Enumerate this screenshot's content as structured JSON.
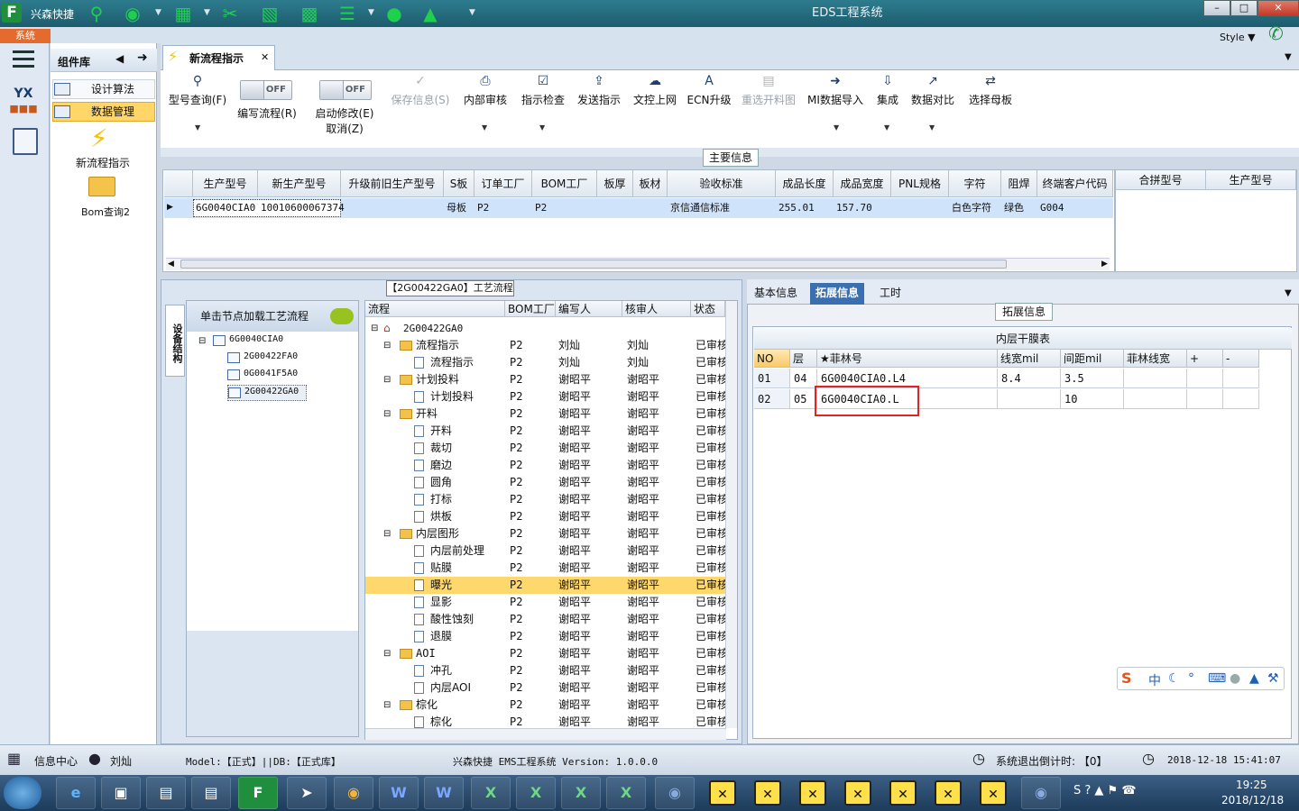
{
  "window": {
    "app_name": "兴森快捷",
    "title": "EDS工程系统",
    "menu_tab": "系统",
    "style_label": "Style"
  },
  "sidebar": {
    "panel_title": "组件库",
    "items": [
      {
        "label": "设计算法"
      },
      {
        "label": "数据管理"
      }
    ],
    "shortcuts": [
      {
        "label": "新流程指示"
      },
      {
        "label": "Bom查询2"
      }
    ]
  },
  "doc_tab": {
    "label": "新流程指示"
  },
  "toolbar": {
    "model_query": "型号查询(F)",
    "toggle_off": "OFF",
    "edit_flow": "编写流程(R)",
    "start_modify": "启动修改(E)",
    "cancel": "取消(Z)",
    "save_info": "保存信息(S)",
    "internal_review": "内部审核",
    "instruction_check": "指示检查",
    "send_instruction": "发送指示",
    "doc_control": "文控上网",
    "ecn_upgrade": "ECN升级",
    "reselect_cut": "重选开料图",
    "mi_import": "MI数据导入",
    "integrate": "集成",
    "data_compare": "数据对比",
    "select_master": "选择母板"
  },
  "main_info": {
    "legend": "主要信息",
    "columns": [
      "生产型号",
      "新生产型号",
      "升级前旧生产型号",
      "S板",
      "订单工厂",
      "BOM工厂",
      "板厚",
      "板材",
      "验收标准",
      "成品长度",
      "成品宽度",
      "PNL规格",
      "字符",
      "阻焊",
      "终端客户代码"
    ],
    "row": [
      "6G0040CIA0",
      "10010600067374",
      "",
      "母板",
      "P2",
      "P2",
      "",
      "",
      "京信通信标准",
      "255.01",
      "157.70",
      "",
      "白色字符",
      "绿色",
      "G004"
    ],
    "side_columns": [
      "合拼型号",
      "生产型号"
    ]
  },
  "flow_panel": {
    "legend": "【2G00422GA0】工艺流程",
    "vert_tab": "设备结构",
    "node_head": "单击节点加载工艺流程",
    "tree": [
      {
        "label": "6G0040CIA0"
      },
      {
        "label": "2G00422FA0"
      },
      {
        "label": "0G0041F5A0"
      },
      {
        "label": "2G00422GA0"
      }
    ],
    "columns": [
      "流程",
      "BOM工厂",
      "编写人",
      "核审人",
      "状态"
    ],
    "root": "2G00422GA0",
    "rows": [
      {
        "name": "流程指示",
        "type": "folder",
        "bom": "P2",
        "writer": "刘灿",
        "reviewer": "刘灿",
        "status": "已审核"
      },
      {
        "name": "流程指示",
        "type": "doc",
        "bom": "P2",
        "writer": "刘灿",
        "reviewer": "刘灿",
        "status": "已审核"
      },
      {
        "name": "计划投料",
        "type": "folder",
        "bom": "P2",
        "writer": "谢昭平",
        "reviewer": "谢昭平",
        "status": "已审核"
      },
      {
        "name": "计划投料",
        "type": "doc",
        "bom": "P2",
        "writer": "谢昭平",
        "reviewer": "谢昭平",
        "status": "已审核"
      },
      {
        "name": "开料",
        "type": "folder",
        "bom": "P2",
        "writer": "谢昭平",
        "reviewer": "谢昭平",
        "status": "已审核"
      },
      {
        "name": "开料",
        "type": "doc",
        "bom": "P2",
        "writer": "谢昭平",
        "reviewer": "谢昭平",
        "status": "已审核"
      },
      {
        "name": "裁切",
        "type": "doc",
        "bom": "P2",
        "writer": "谢昭平",
        "reviewer": "谢昭平",
        "status": "已审核"
      },
      {
        "name": "磨边",
        "type": "doc",
        "bom": "P2",
        "writer": "谢昭平",
        "reviewer": "谢昭平",
        "status": "已审核"
      },
      {
        "name": "圆角",
        "type": "doc",
        "bom": "P2",
        "writer": "谢昭平",
        "reviewer": "谢昭平",
        "status": "已审核"
      },
      {
        "name": "打标",
        "type": "doc",
        "bom": "P2",
        "writer": "谢昭平",
        "reviewer": "谢昭平",
        "status": "已审核"
      },
      {
        "name": "烘板",
        "type": "doc",
        "bom": "P2",
        "writer": "谢昭平",
        "reviewer": "谢昭平",
        "status": "已审核"
      },
      {
        "name": "内层图形",
        "type": "folder",
        "bom": "P2",
        "writer": "谢昭平",
        "reviewer": "谢昭平",
        "status": "已审核"
      },
      {
        "name": "内层前处理",
        "type": "doc",
        "bom": "P2",
        "writer": "谢昭平",
        "reviewer": "谢昭平",
        "status": "已审核"
      },
      {
        "name": "贴膜",
        "type": "doc",
        "bom": "P2",
        "writer": "谢昭平",
        "reviewer": "谢昭平",
        "status": "已审核"
      },
      {
        "name": "曝光",
        "type": "doc",
        "bom": "P2",
        "writer": "谢昭平",
        "reviewer": "谢昭平",
        "status": "已审核"
      },
      {
        "name": "显影",
        "type": "doc",
        "bom": "P2",
        "writer": "谢昭平",
        "reviewer": "谢昭平",
        "status": "已审核"
      },
      {
        "name": "酸性蚀刻",
        "type": "doc",
        "bom": "P2",
        "writer": "谢昭平",
        "reviewer": "谢昭平",
        "status": "已审核"
      },
      {
        "name": "退膜",
        "type": "doc",
        "bom": "P2",
        "writer": "谢昭平",
        "reviewer": "谢昭平",
        "status": "已审核"
      },
      {
        "name": "AOI",
        "type": "folder",
        "bom": "P2",
        "writer": "谢昭平",
        "reviewer": "谢昭平",
        "status": "已审核"
      },
      {
        "name": "冲孔",
        "type": "doc",
        "bom": "P2",
        "writer": "谢昭平",
        "reviewer": "谢昭平",
        "status": "已审核"
      },
      {
        "name": "内层AOI",
        "type": "doc",
        "bom": "P2",
        "writer": "谢昭平",
        "reviewer": "谢昭平",
        "status": "已审核"
      },
      {
        "name": "棕化",
        "type": "folder",
        "bom": "P2",
        "writer": "谢昭平",
        "reviewer": "谢昭平",
        "status": "已审核"
      },
      {
        "name": "棕化",
        "type": "doc",
        "bom": "P2",
        "writer": "谢昭平",
        "reviewer": "谢昭平",
        "status": "已审核"
      }
    ]
  },
  "right_panel": {
    "tabs": [
      "基本信息",
      "拓展信息",
      "工时"
    ],
    "legend": "拓展信息",
    "table_title": "内层干膜表",
    "columns": [
      "NO",
      "层",
      "★菲林号",
      "线宽mil",
      "间距mil",
      "菲林线宽",
      "+",
      "-"
    ],
    "rows": [
      [
        "01",
        "04",
        "6G0040CIA0.L4",
        "8.4",
        "3.5",
        "",
        "",
        ""
      ],
      [
        "02",
        "05",
        "6G0040CIA0.L",
        "",
        "10",
        "",
        "",
        ""
      ]
    ],
    "ime": "中"
  },
  "status": {
    "info_center": "信息中心",
    "user": "刘灿",
    "model_db": "Model:【正式】||DB:【正式库】",
    "version": "兴森快捷 EMS工程系统 Version: 1.0.0.0",
    "countdown": "系统退出倒计时: 【0】",
    "datetime": "2018-12-18 15:41:07"
  },
  "taskbar": {
    "time": "19:25",
    "date": "2018/12/18"
  },
  "colors": {
    "selection": "#ffd86d",
    "highlight_box": "#e02424",
    "active_tab": "#3b6fb0"
  }
}
